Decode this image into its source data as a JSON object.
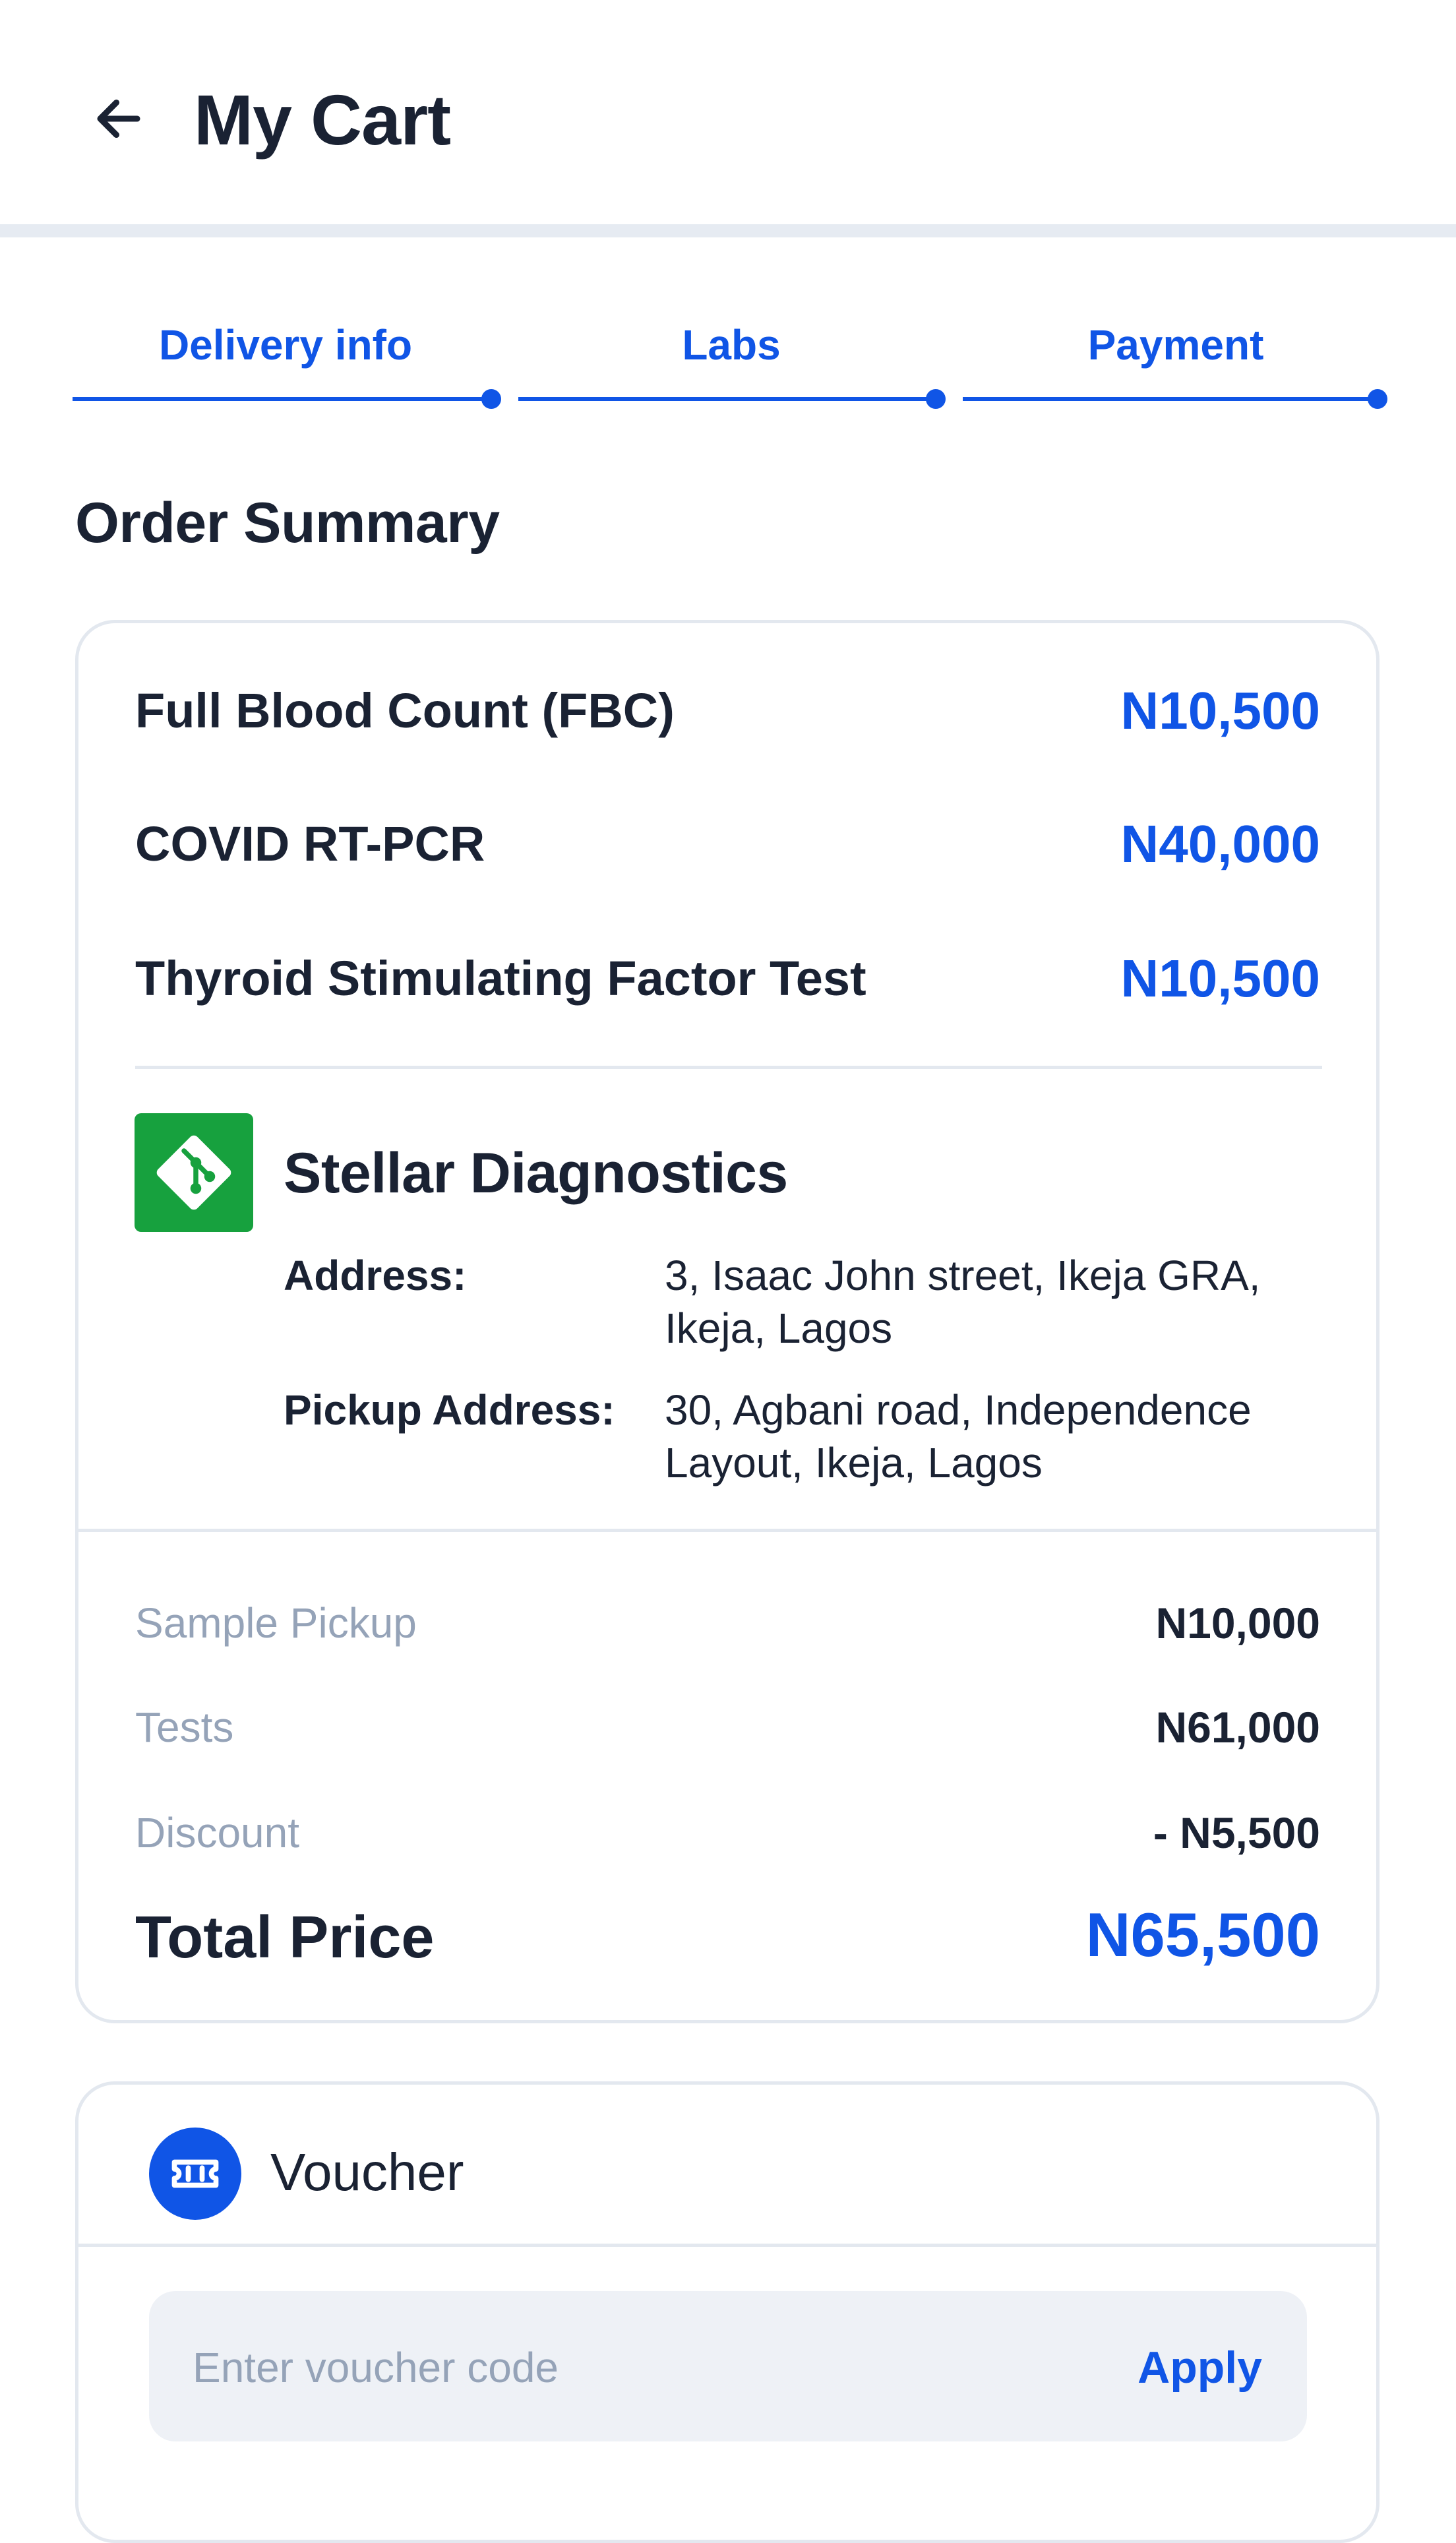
{
  "header": {
    "title": "My Cart",
    "back_icon": "arrow-left-icon"
  },
  "steps": [
    {
      "label": "Delivery info"
    },
    {
      "label": "Labs"
    },
    {
      "label": "Payment"
    }
  ],
  "order_summary": {
    "title": "Order Summary",
    "items": [
      {
        "name": "Full Blood Count (FBC)",
        "price": "N10,500"
      },
      {
        "name": "COVID RT-PCR",
        "price": "N40,000"
      },
      {
        "name": "Thyroid Stimulating Factor Test",
        "price": "N10,500"
      }
    ],
    "lab": {
      "name": "Stellar Diagnostics",
      "logo_icon": "git-diamond-icon",
      "address_label": "Address:",
      "address_line1": "3, Isaac John street, Ikeja GRA,",
      "address_line2": "Ikeja, Lagos",
      "pickup_label": "Pickup Address:",
      "pickup_line1": "30, Agbani road, Independence",
      "pickup_line2": "Layout, Ikeja, Lagos"
    },
    "fees": [
      {
        "label": "Sample Pickup",
        "value": "N10,000"
      },
      {
        "label": "Tests",
        "value": "N61,000"
      },
      {
        "label": "Discount",
        "value": "- N5,500"
      }
    ],
    "total_label": "Total Price",
    "total_value": "N65,500"
  },
  "voucher": {
    "title": "Voucher",
    "icon": "ticket-icon",
    "placeholder": "Enter voucher code",
    "apply_label": "Apply"
  },
  "colors": {
    "accent": "#1055e6",
    "lab_logo": "#17a13e",
    "muted": "#95a3b8",
    "text": "#1a2233",
    "border": "#e3e8ef"
  }
}
